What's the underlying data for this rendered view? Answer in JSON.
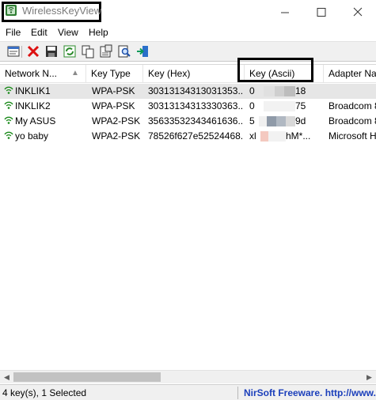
{
  "window": {
    "title": "WirelessKeyView",
    "controls": {
      "minimize": "minimize",
      "maximize": "maximize",
      "close": "close"
    }
  },
  "menu": [
    "File",
    "Edit",
    "View",
    "Help"
  ],
  "toolbar": {
    "icons": [
      "properties-icon",
      "delete-icon",
      "save-icon",
      "refresh-icon",
      "copy-icon",
      "html-report-icon",
      "find-icon",
      "exit-icon"
    ]
  },
  "columns": [
    "Network N...",
    "Key Type",
    "Key (Hex)",
    "Key (Ascii)",
    "Adapter Na"
  ],
  "sort_arrow": "▲",
  "rows": [
    {
      "name": "INKLIK1",
      "type": "WPA-PSK",
      "hex": "30313134313031353...",
      "ascii_start": "0",
      "ascii_end": "18",
      "adapter": "",
      "selected": true
    },
    {
      "name": "INKLIK2",
      "type": "WPA-PSK",
      "hex": "30313134313330363...",
      "ascii_start": "0",
      "ascii_end": "75",
      "adapter": "Broadcom 8",
      "selected": false
    },
    {
      "name": "My ASUS",
      "type": "WPA2-PSK",
      "hex": "35633532343461636...",
      "ascii_start": "5",
      "ascii_end": "9d",
      "adapter": "Broadcom 8",
      "selected": false
    },
    {
      "name": "yo baby",
      "type": "WPA2-PSK",
      "hex": "78526f627e52524468...",
      "ascii_start": "xl",
      "ascii_end": "hM*...",
      "adapter": "Microsoft H",
      "selected": false
    }
  ],
  "status": {
    "count": "4 key(s), 1 Selected",
    "link": "NirSoft Freeware.  http://www."
  },
  "colors": {
    "selection": "#e6e6e6",
    "link": "#1b3fbb",
    "highlight_box": "#000000"
  }
}
